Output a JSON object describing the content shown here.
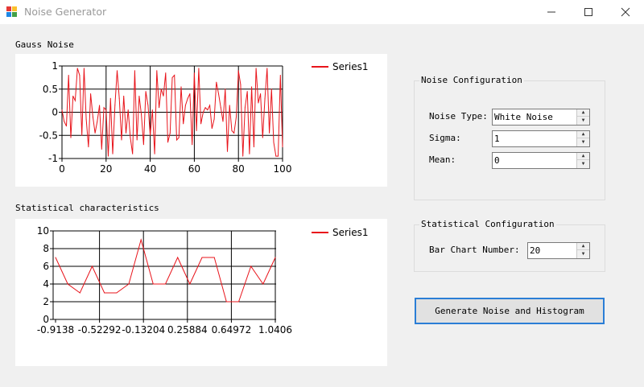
{
  "window": {
    "title": "Noise Generator",
    "icon": "app-icon",
    "controls": [
      "minimize-icon",
      "maximize-icon",
      "close-icon"
    ]
  },
  "gauss_section": {
    "label": "Gauss Noise"
  },
  "stats_section": {
    "label": "Statistical characteristics"
  },
  "noise_config": {
    "title": "Noise Configuration",
    "noise_type_label": "Noise Type:",
    "noise_type_value": "White Noise",
    "sigma_label": "Sigma:",
    "sigma_value": "1",
    "mean_label": "Mean:",
    "mean_value": "0"
  },
  "stat_config": {
    "title": "Statistical Configuration",
    "bar_chart_label": "Bar Chart Number:",
    "bar_chart_value": "20"
  },
  "generate_button": {
    "label": "Generate Noise and Histogram"
  },
  "colors": {
    "series": "#e8141b",
    "accent_border": "#2b7ed6",
    "background": "#f0f0f0"
  },
  "chart_data": [
    {
      "type": "line",
      "title": "",
      "xlabel": "",
      "ylabel": "",
      "xlim": [
        0,
        100
      ],
      "ylim": [
        -1,
        1
      ],
      "x_ticks": [
        "0",
        "20",
        "40",
        "60",
        "80",
        "100"
      ],
      "y_ticks": [
        "1",
        "0.5",
        "0",
        "-0.5",
        "-1"
      ],
      "legend": "top-right",
      "grid": true,
      "series": [
        {
          "name": "Series1",
          "values": [
            0.05,
            -0.2,
            -0.3,
            0.8,
            -0.55,
            0.35,
            0.25,
            0.95,
            0.8,
            -0.5,
            0.95,
            -0.15,
            -0.75,
            0.4,
            -0.1,
            -0.45,
            -0.2,
            0.15,
            -0.8,
            0.1,
            0.05,
            -0.95,
            0.3,
            -0.9,
            0.15,
            0.9,
            0.3,
            -0.6,
            0.35,
            -0.45,
            0.05,
            -0.55,
            -0.9,
            0.9,
            -0.6,
            0.35,
            -0.05,
            -0.7,
            0.45,
            0.15,
            -0.5,
            0.05,
            -0.9,
            0.9,
            0.1,
            0.5,
            0.35,
            0.85,
            -0.65,
            -0.45,
            0.75,
            0.8,
            -0.6,
            -0.55,
            0.55,
            -0.25,
            0.15,
            0.3,
            0.4,
            -0.7,
            0.85,
            -0.4,
            0.95,
            -0.25,
            0.0,
            0.1,
            0.05,
            0.15,
            -0.35,
            -0.15,
            0.65,
            0.4,
            0.1,
            -0.2,
            0.5,
            -0.85,
            0.15,
            -0.4,
            -0.45,
            -0.1,
            0.9,
            0.6,
            -0.95,
            0.1,
            0.45,
            -0.9,
            0.55,
            -0.75,
            0.95,
            0.2,
            0.4,
            -0.55,
            0.3,
            0.95,
            -0.45,
            0.5,
            -0.65,
            -0.95,
            -0.95,
            0.8,
            -0.75
          ]
        }
      ]
    },
    {
      "type": "line",
      "title": "",
      "xlabel": "",
      "ylabel": "",
      "ylim": [
        0,
        10
      ],
      "x_ticks": [
        "-0.9138",
        "-0.52292",
        "-0.13204",
        "0.25884",
        "0.64972",
        "1.0406"
      ],
      "y_ticks": [
        "10",
        "8",
        "6",
        "4",
        "2",
        "0"
      ],
      "legend": "top-right",
      "grid": true,
      "series": [
        {
          "name": "Series1",
          "values": [
            7,
            4,
            3,
            6,
            3,
            3,
            4,
            9,
            4,
            4,
            7,
            4,
            7,
            7,
            2,
            2,
            6,
            4,
            7
          ]
        }
      ]
    }
  ]
}
